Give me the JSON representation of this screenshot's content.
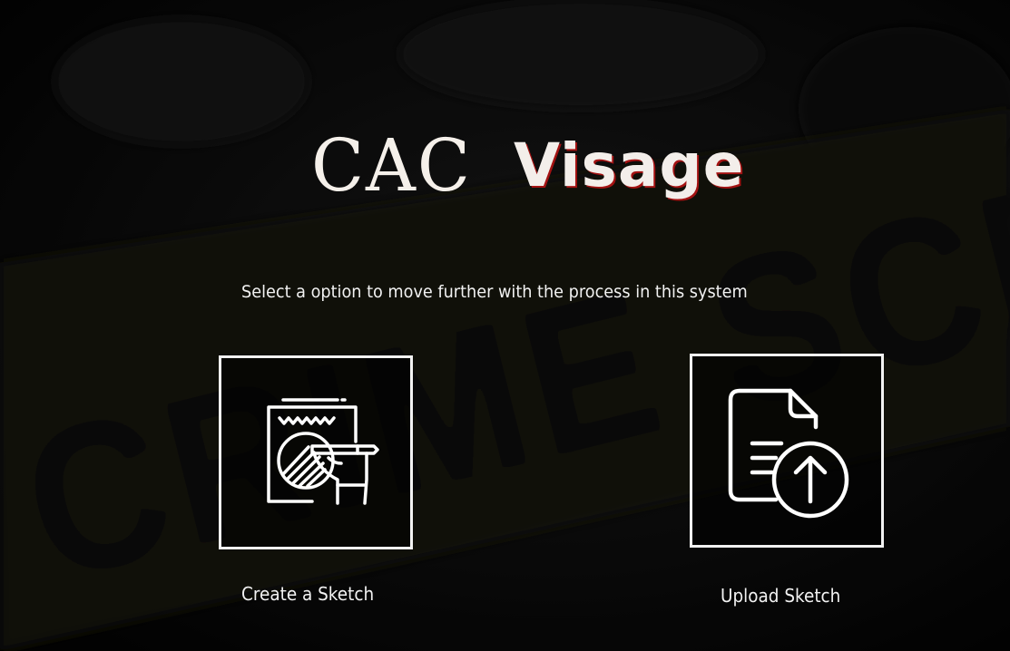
{
  "brand": {
    "part1": "CAC",
    "part2": "Visage",
    "accent_color": "#a31212"
  },
  "background": {
    "tape_text": "CRIME SCENE DO"
  },
  "subtitle": "Select a option to move further with the process in this system",
  "options": [
    {
      "label": "Create a Sketch",
      "icon": "sketch-drawing-icon"
    },
    {
      "label": "Upload Sketch",
      "icon": "document-upload-icon"
    }
  ]
}
